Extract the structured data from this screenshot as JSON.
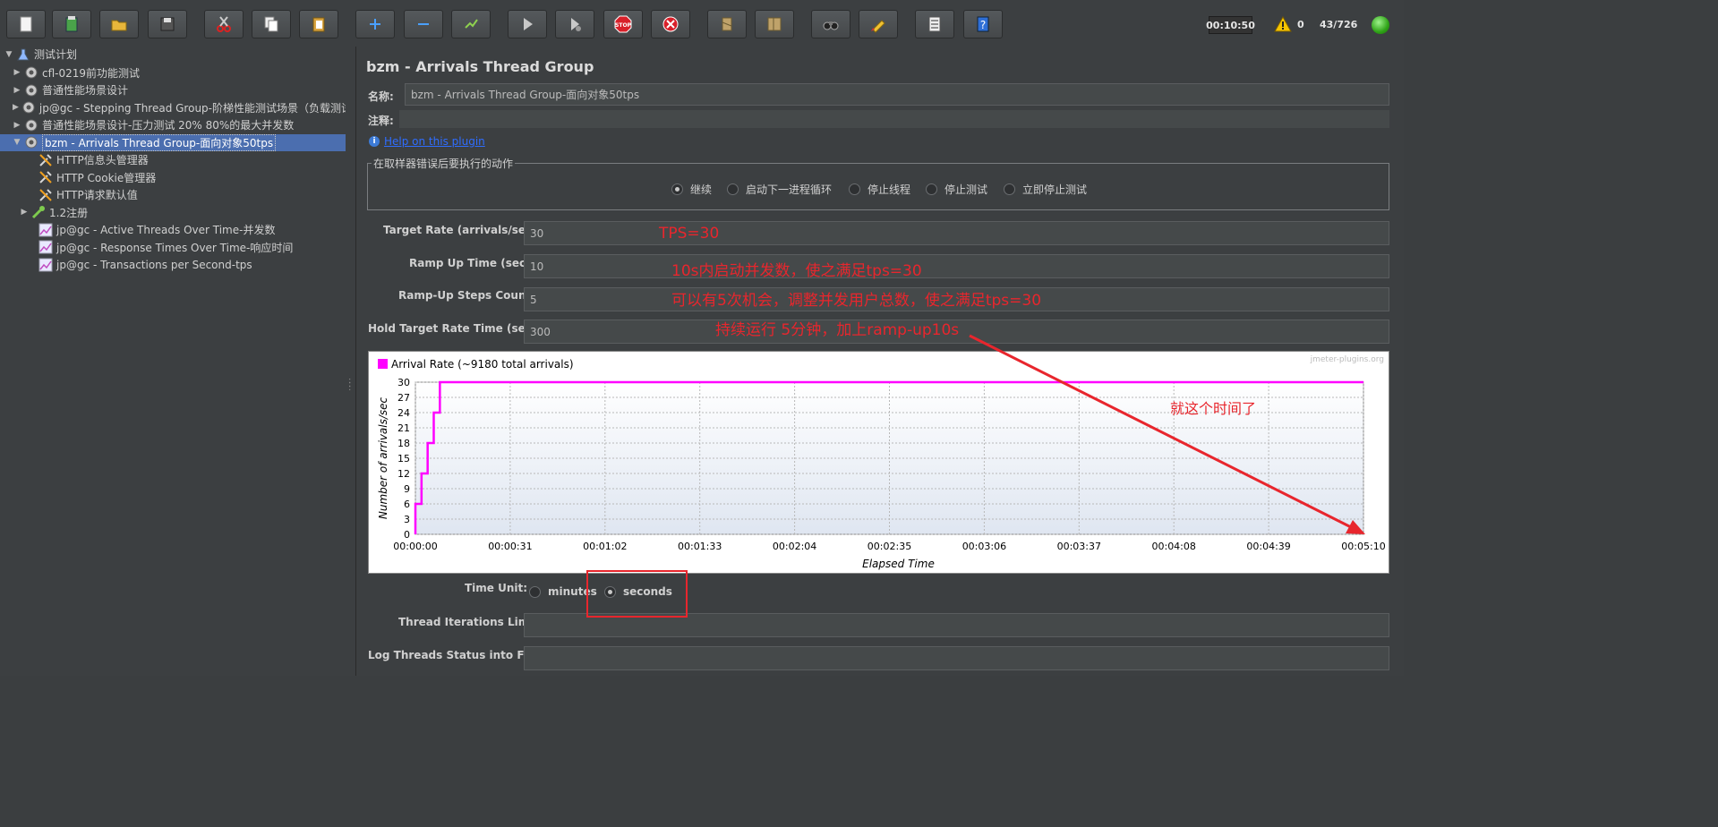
{
  "toolbar": {
    "buttons": [
      {
        "name": "new-icon"
      },
      {
        "name": "templates-icon"
      },
      {
        "name": "open-icon"
      },
      {
        "name": "save-icon"
      },
      {
        "name": "cut-icon"
      },
      {
        "name": "copy-icon"
      },
      {
        "name": "paste-icon"
      },
      {
        "name": "expand-all-icon"
      },
      {
        "name": "collapse-all-icon"
      },
      {
        "name": "toggle-icon"
      },
      {
        "name": "start-icon"
      },
      {
        "name": "start-no-timers-icon"
      },
      {
        "name": "stop-icon"
      },
      {
        "name": "shutdown-icon"
      },
      {
        "name": "clear-icon"
      },
      {
        "name": "clear-all-icon"
      },
      {
        "name": "search-icon"
      },
      {
        "name": "reset-search-icon"
      },
      {
        "name": "function-helper-icon"
      },
      {
        "name": "help-icon"
      }
    ],
    "stop_label": "STOP",
    "timer": "00:10:50",
    "warning_count": "0",
    "thread_count": "43/726"
  },
  "tree": {
    "items": [
      {
        "label": "测试计划",
        "icon": "test-plan-icon",
        "toggle": "▼"
      },
      {
        "label": "cfl-0219前功能测试",
        "icon": "gear-icon",
        "toggle": "▶"
      },
      {
        "label": "普通性能场景设计",
        "icon": "gear-icon",
        "toggle": "▶"
      },
      {
        "label": "jp@gc - Stepping Thread Group-阶梯性能测试场景（负载测试）",
        "icon": "gear-icon",
        "toggle": "▶"
      },
      {
        "label": "普通性能场景设计-压力测试 20% 80%的最大并发数",
        "icon": "gear-icon",
        "toggle": "▶"
      },
      {
        "label": "bzm - Arrivals Thread Group-面向对象50tps",
        "icon": "gear-icon",
        "toggle": "▼"
      },
      {
        "label": "HTTP信息头管理器",
        "icon": "wrench-icon",
        "toggle": ""
      },
      {
        "label": "HTTP Cookie管理器",
        "icon": "wrench-icon",
        "toggle": ""
      },
      {
        "label": "HTTP请求默认值",
        "icon": "wrench-icon",
        "toggle": ""
      },
      {
        "label": "1.2注册",
        "icon": "pipette-icon",
        "toggle": "▶"
      },
      {
        "label": "jp@gc - Active Threads Over Time-并发数",
        "icon": "graph-icon",
        "toggle": ""
      },
      {
        "label": "jp@gc - Response Times Over Time-响应时间",
        "icon": "graph-icon",
        "toggle": ""
      },
      {
        "label": "jp@gc - Transactions per Second-tps",
        "icon": "graph-icon",
        "toggle": ""
      }
    ]
  },
  "panel": {
    "title": "bzm - Arrivals Thread Group",
    "name_label": "名称:",
    "name_value": "bzm - Arrivals Thread Group-面向对象50tps",
    "comment_label": "注释:",
    "comment_value": "",
    "help_link": "Help on this plugin",
    "error_group_title": "在取样器错误后要执行的动作",
    "error_actions": [
      {
        "label": "继续",
        "selected": true
      },
      {
        "label": "启动下一进程循环",
        "selected": false
      },
      {
        "label": "停止线程",
        "selected": false
      },
      {
        "label": "停止测试",
        "selected": false
      },
      {
        "label": "立即停止测试",
        "selected": false
      }
    ],
    "target_rate_label": "Target Rate (arrivals/sec):",
    "target_rate_value": "30",
    "ramp_up_label": "Ramp Up Time (sec):",
    "ramp_up_value": "10",
    "steps_label": "Ramp-Up Steps Count:",
    "steps_value": "5",
    "hold_label": "Hold Target Rate Time (sec):",
    "hold_value": "300",
    "time_unit_label": "Time Unit:",
    "time_unit_options": [
      {
        "label": "minutes",
        "selected": false
      },
      {
        "label": "seconds",
        "selected": true
      }
    ],
    "iterations_label": "Thread Iterations Limit:",
    "iterations_value": "",
    "log_label": "Log Threads Status into File:",
    "log_value": ""
  },
  "annotations": {
    "note1": "TPS=30",
    "note2": "10s内启动并发数，使之满足tps=30",
    "note3": "可以有5次机会，调整并发用户总数，使之满足tps=30",
    "note4": "持续运行 5分钟，加上ramp-up10s",
    "note5": "就这个时间了",
    "red_color": "#e8262d"
  },
  "chart_data": {
    "type": "line",
    "legend": "Arrival Rate (~9180 total arrivals)",
    "watermark": "jmeter-plugins.org",
    "xlabel": "Elapsed Time",
    "ylabel": "Number of arrivals/sec",
    "x_ticks": [
      "00:00:00",
      "00:00:31",
      "00:01:02",
      "00:01:33",
      "00:02:04",
      "00:02:35",
      "00:03:06",
      "00:03:37",
      "00:04:08",
      "00:04:39",
      "00:05:10"
    ],
    "y_ticks": [
      0,
      3,
      6,
      9,
      12,
      15,
      18,
      21,
      24,
      27,
      30
    ],
    "xlim_seconds": [
      0,
      310
    ],
    "ylim": [
      0,
      30
    ],
    "series": [
      {
        "name": "Arrival Rate",
        "color": "#ff00ff",
        "points_seconds": [
          [
            0,
            0
          ],
          [
            0,
            6
          ],
          [
            2,
            6
          ],
          [
            2,
            12
          ],
          [
            4,
            12
          ],
          [
            4,
            18
          ],
          [
            6,
            18
          ],
          [
            6,
            24
          ],
          [
            8,
            24
          ],
          [
            8,
            30
          ],
          [
            310,
            30
          ]
        ]
      }
    ]
  }
}
